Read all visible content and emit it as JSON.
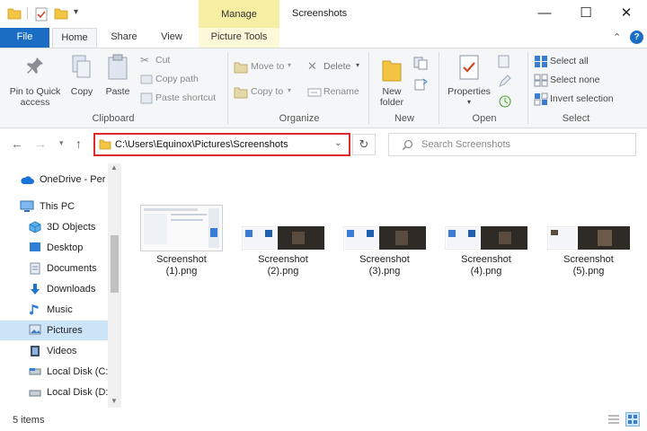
{
  "titlebar": {
    "manage_label": "Manage",
    "title": "Screenshots",
    "minimize": "—",
    "maximize": "☐",
    "close": "✕"
  },
  "tabs": {
    "file": "File",
    "home": "Home",
    "share": "Share",
    "view": "View",
    "picture_tools": "Picture Tools"
  },
  "ribbon": {
    "clipboard": {
      "label": "Clipboard",
      "pin_line1": "Pin to Quick",
      "pin_line2": "access",
      "copy": "Copy",
      "paste": "Paste",
      "cut": "Cut",
      "copy_path": "Copy path",
      "paste_shortcut": "Paste shortcut"
    },
    "organize": {
      "label": "Organize",
      "move_to": "Move to",
      "copy_to": "Copy to",
      "delete": "Delete",
      "rename": "Rename"
    },
    "new": {
      "label": "New",
      "new_folder_line1": "New",
      "new_folder_line2": "folder"
    },
    "open": {
      "label": "Open",
      "properties": "Properties"
    },
    "select": {
      "label": "Select",
      "select_all": "Select all",
      "select_none": "Select none",
      "invert_selection": "Invert selection"
    }
  },
  "address": {
    "path": "C:\\Users\\Equinox\\Pictures\\Screenshots",
    "search_placeholder": "Search Screenshots"
  },
  "sidebar": {
    "items": [
      {
        "label": "OneDrive - Per",
        "icon": "cloud-icon"
      },
      {
        "label": "This PC",
        "icon": "computer-icon"
      },
      {
        "label": "3D Objects",
        "icon": "cube-icon"
      },
      {
        "label": "Desktop",
        "icon": "desktop-icon"
      },
      {
        "label": "Documents",
        "icon": "documents-icon"
      },
      {
        "label": "Downloads",
        "icon": "download-icon"
      },
      {
        "label": "Music",
        "icon": "music-icon"
      },
      {
        "label": "Pictures",
        "icon": "pictures-icon"
      },
      {
        "label": "Videos",
        "icon": "videos-icon"
      },
      {
        "label": "Local Disk (C:",
        "icon": "disk-icon"
      },
      {
        "label": "Local Disk (D:",
        "icon": "disk-icon"
      }
    ],
    "selected": "Pictures"
  },
  "files": [
    {
      "line1": "Screenshot",
      "line2": "(1).png"
    },
    {
      "line1": "Screenshot",
      "line2": "(2).png"
    },
    {
      "line1": "Screenshot",
      "line2": "(3).png"
    },
    {
      "line1": "Screenshot",
      "line2": "(4).png"
    },
    {
      "line1": "Screenshot",
      "line2": "(5).png"
    }
  ],
  "status": {
    "items": "5 items"
  },
  "colors": {
    "file_tab": "#1a6dc2",
    "manage_tab": "#f6efa3",
    "selected_nav": "#cce4f7",
    "address_highlight": "#e02a2a"
  }
}
